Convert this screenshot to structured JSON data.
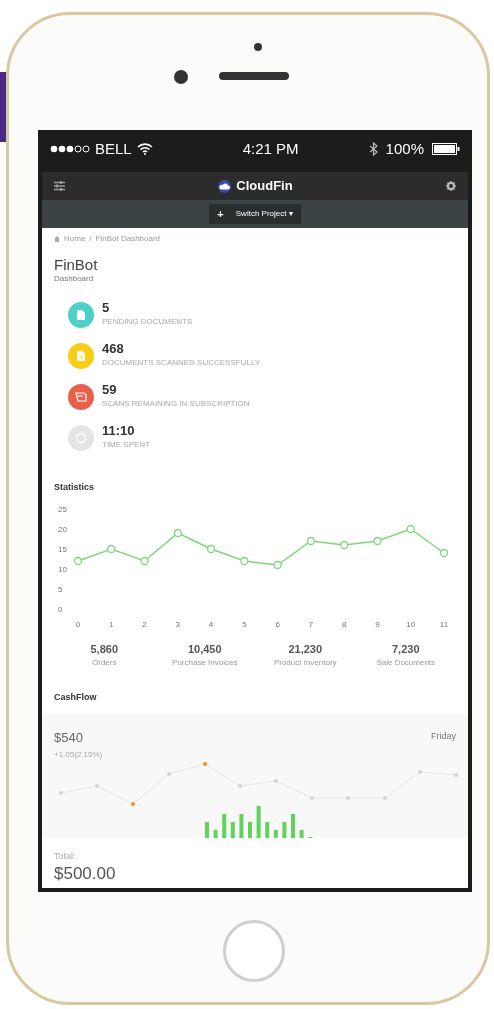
{
  "status_bar": {
    "carrier": "BELL",
    "time": "4:21 PM",
    "battery": "100%"
  },
  "navbar": {
    "title": "CloudFin"
  },
  "toolbar": {
    "add_button": "+",
    "switch_project": "Switch Project ▾"
  },
  "breadcrumb": {
    "items": [
      "Home",
      "FinBot Dashboard"
    ],
    "separator": "/"
  },
  "page": {
    "title": "FinBot",
    "subtitle": "Dashboard"
  },
  "stats": [
    {
      "value": "5",
      "label": "PENDING DOCUMENTS",
      "color": "#4dd0c8"
    },
    {
      "value": "468",
      "label": "DOCUMENTS SCANNED SUCCESSFULLY",
      "color": "#f9cc16"
    },
    {
      "value": "59",
      "label": "SCANS REMAINING IN SUBSCRIPTION",
      "color": "#e8604c"
    },
    {
      "value": "11:10",
      "label": "TIME SPENT",
      "color": "#e4e4e4"
    }
  ],
  "statistics": {
    "chart_data": {
      "type": "line",
      "title": "Statistics",
      "x": [
        0,
        1,
        2,
        3,
        4,
        5,
        6,
        7,
        8,
        9,
        10,
        11
      ],
      "series": [
        {
          "color": "#7ed67a",
          "marker": "circle",
          "values": [
            12,
            15,
            12,
            19,
            15,
            12,
            11,
            17,
            16,
            17,
            20,
            14
          ]
        }
      ],
      "xlim": [
        0,
        11
      ],
      "ylim": [
        0,
        25
      ],
      "yticks": [
        0,
        5,
        10,
        15,
        20,
        25
      ],
      "xticks": [
        0,
        1,
        2,
        3,
        4,
        5,
        6,
        7,
        8,
        9,
        10,
        11
      ]
    }
  },
  "summary": [
    {
      "value": "5,860",
      "label": "Orders"
    },
    {
      "value": "10,450",
      "label": "Purchase Invoices"
    },
    {
      "value": "21,230",
      "label": "Product Inventory"
    },
    {
      "value": "7,230",
      "label": "Sale Documents"
    }
  ],
  "cashflow": {
    "title": "CashFlow",
    "amount": "$540",
    "change": "+1.05(2.15%)",
    "day": "Friday",
    "total_label": "Total:",
    "total": "$500.00"
  }
}
